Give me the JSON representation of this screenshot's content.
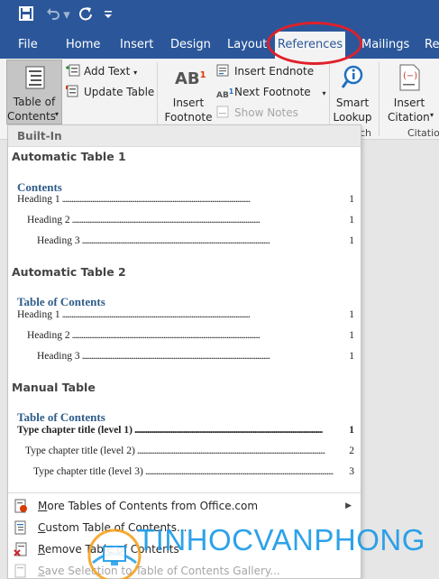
{
  "quick_access": {
    "save_icon": "save-icon",
    "undo_icon": "undo-icon",
    "redo_icon": "redo-icon",
    "customize_icon": "customize-quick-access-icon"
  },
  "tabs": [
    {
      "label": "File"
    },
    {
      "label": "Home"
    },
    {
      "label": "Insert"
    },
    {
      "label": "Design"
    },
    {
      "label": "Layout"
    },
    {
      "label": "References",
      "active": true
    },
    {
      "label": "Mailings"
    },
    {
      "label": "Rev"
    }
  ],
  "ribbon": {
    "toc": {
      "line1": "Table of",
      "line2": "Contents"
    },
    "add_text": "Add Text",
    "update_table": "Update Table",
    "insert_footnote": {
      "line1": "Insert",
      "line2": "Footnote"
    },
    "insert_endnote": "Insert Endnote",
    "next_footnote": "Next Footnote",
    "show_notes": "Show Notes",
    "smart_lookup": {
      "line1": "Smart",
      "line2": "Lookup"
    },
    "insert_citation": {
      "line1": "Insert",
      "line2": "Citation"
    },
    "group_research_partial": "ch",
    "group_citations_partial": "Citatio"
  },
  "gallery": {
    "header": "Built-In",
    "sections": [
      {
        "name": "Automatic Table 1",
        "toc_title": "Contents",
        "lines": [
          {
            "text": "Heading 1",
            "page": "1"
          },
          {
            "text": "Heading 2",
            "page": "1"
          },
          {
            "text": "Heading 3",
            "page": "1"
          }
        ]
      },
      {
        "name": "Automatic Table 2",
        "toc_title": "Table of Contents",
        "lines": [
          {
            "text": "Heading 1",
            "page": "1"
          },
          {
            "text": "Heading 2",
            "page": "1"
          },
          {
            "text": "Heading 3",
            "page": "1"
          }
        ]
      },
      {
        "name": "Manual Table",
        "toc_title": "Table of Contents",
        "lines": [
          {
            "text": "Type chapter title (level 1)",
            "page": "1"
          },
          {
            "text": "Type chapter title (level 2)",
            "page": "2"
          },
          {
            "text": "Type chapter title (level 3)",
            "page": "3"
          }
        ]
      }
    ],
    "menu": [
      {
        "pre": "",
        "u": "M",
        "post": "ore Tables of Contents from Office.com",
        "disabled": false
      },
      {
        "pre": "",
        "u": "C",
        "post": "ustom Table of Contents...",
        "disabled": false
      },
      {
        "pre": "",
        "u": "R",
        "post": "emove Table of Contents",
        "disabled": false
      },
      {
        "pre": "",
        "u": "S",
        "post": "ave Selection to Table of Contents Gallery...",
        "disabled": true
      }
    ]
  },
  "watermark": {
    "text": "TINHOCVANPHONG"
  },
  "colors": {
    "titlebar": "#2b579a",
    "highlight": "#e0202a",
    "toc_heading": "#2e5c8a",
    "watermark": "#1e9be8"
  }
}
